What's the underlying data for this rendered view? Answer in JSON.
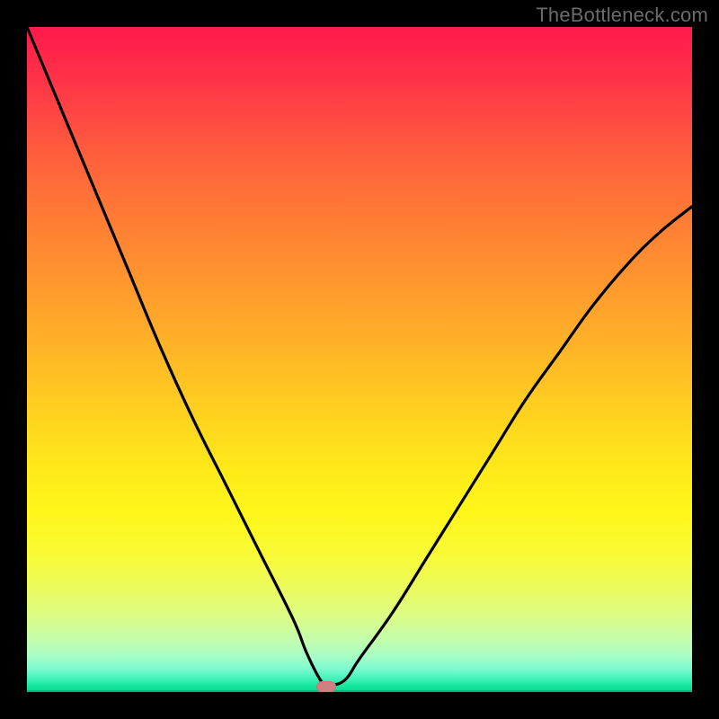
{
  "watermark": "TheBottleneck.com",
  "colors": {
    "background": "#000000",
    "curve": "#000000",
    "marker": "#d08080",
    "gradient_top": "#ff1a4b",
    "gradient_bottom": "#05d88d"
  },
  "chart_data": {
    "type": "line",
    "title": "",
    "xlabel": "",
    "ylabel": "",
    "xlim": [
      0,
      100
    ],
    "ylim": [
      0,
      100
    ],
    "grid": false,
    "legend": false,
    "series": [
      {
        "name": "bottleneck-curve",
        "x": [
          0,
          5,
          10,
          15,
          20,
          25,
          30,
          35,
          40,
          42,
          44,
          45,
          46,
          48,
          50,
          55,
          60,
          65,
          70,
          75,
          80,
          85,
          90,
          95,
          100
        ],
        "y": [
          100,
          88,
          76,
          64,
          52,
          41,
          31,
          21,
          11,
          6,
          2,
          1,
          1,
          2,
          5,
          12,
          20,
          28,
          36,
          44,
          51,
          58,
          64,
          69,
          73
        ]
      }
    ],
    "marker": {
      "x": 45,
      "y": 0.8
    },
    "notes": "Values are read approximately from the plotted curve; the curve has a sharp minimum near x≈45 reaching y≈0, with the right branch asymptotically lower than the left."
  }
}
